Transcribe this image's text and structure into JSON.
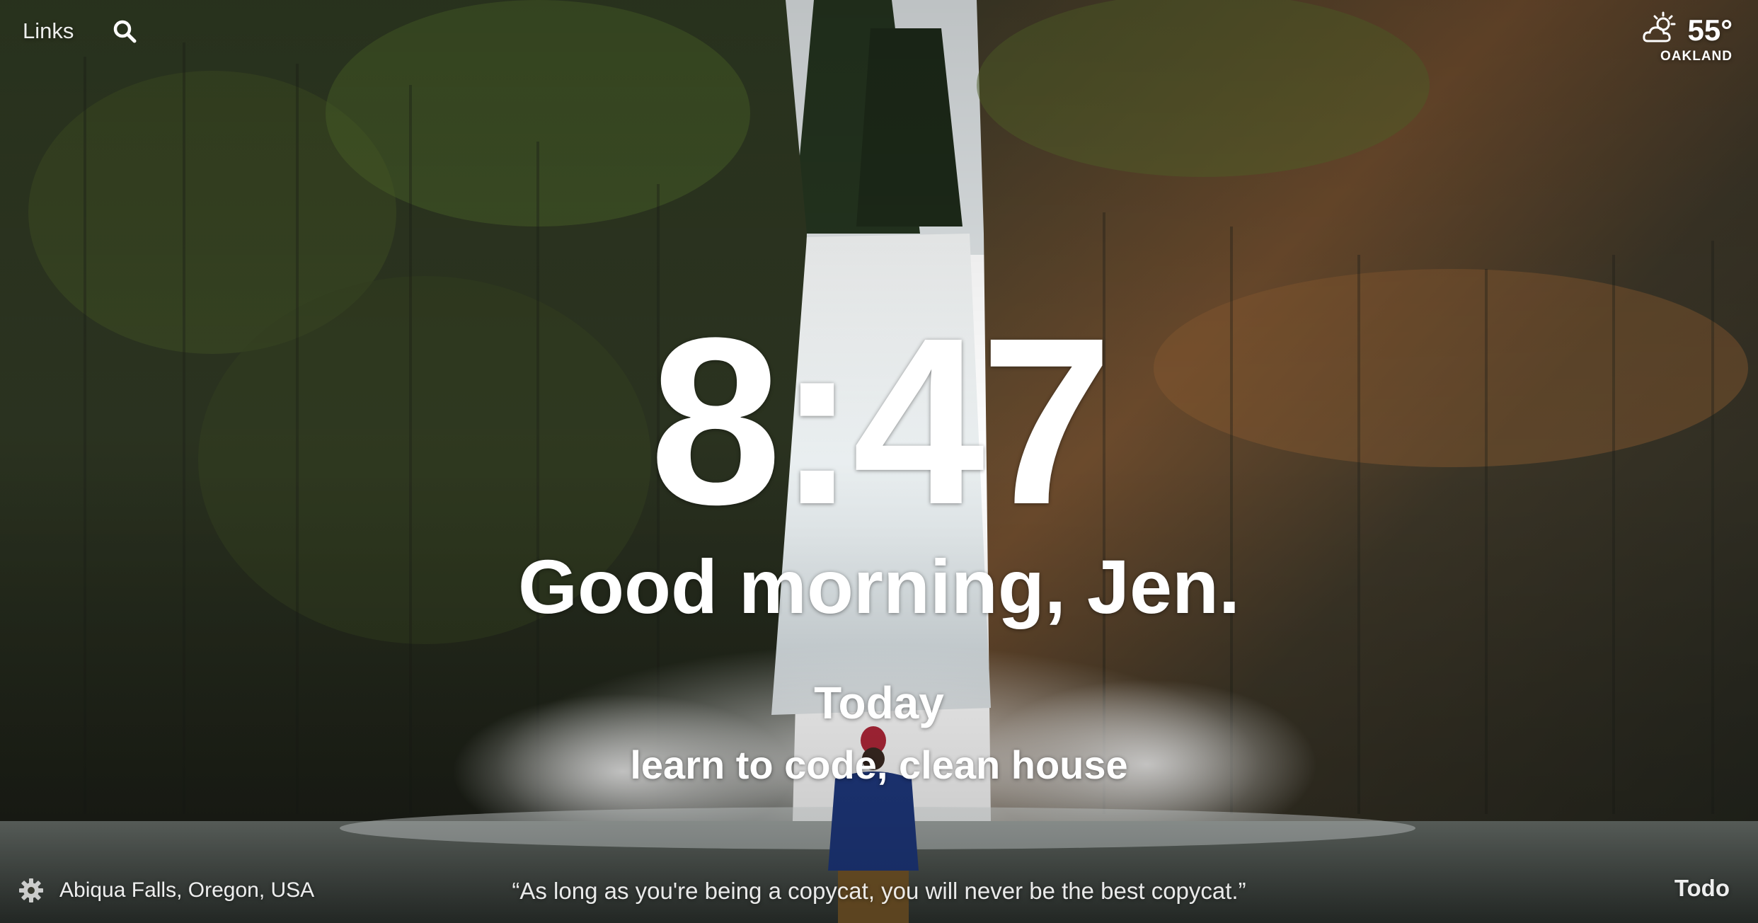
{
  "topbar": {
    "links_label": "Links",
    "search_icon": "search-icon"
  },
  "weather": {
    "icon": "partly-cloudy-icon",
    "temperature": "55°",
    "city": "OAKLAND"
  },
  "clock": {
    "time": "8:47"
  },
  "greeting": {
    "text": "Good morning, Jen."
  },
  "focus": {
    "heading": "Today",
    "text": "learn to code, clean house"
  },
  "footer": {
    "settings_icon": "gear-icon",
    "photo_location": "Abiqua Falls, Oregon, USA",
    "quote": "“As long as you're being a copycat, you will never be the best copycat.”",
    "todo_label": "Todo"
  },
  "colors": {
    "text": "#ffffff",
    "cliff_dark": "#2a2a1e",
    "moss": "#4a5a2a",
    "rust": "#8a5a30",
    "water": "#e8eef0",
    "sky": "#dfe4e6"
  }
}
